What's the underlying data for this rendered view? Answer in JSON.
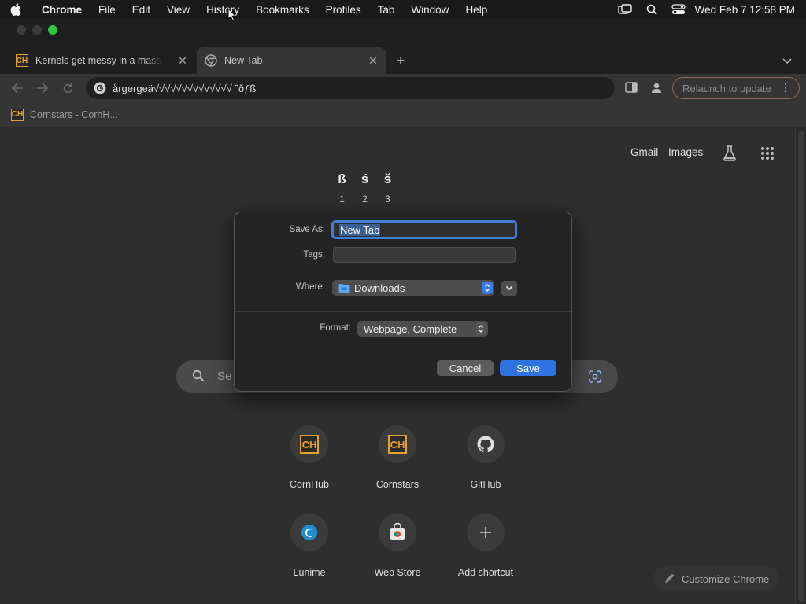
{
  "menubar": {
    "app_name": "Chrome",
    "items": [
      "File",
      "Edit",
      "View",
      "History",
      "Bookmarks",
      "Profiles",
      "Tab",
      "Window",
      "Help"
    ],
    "clock": "Wed Feb 7  12:58 PM"
  },
  "tabs": [
    {
      "title": "Kernels get messy in a mass p",
      "favicon": "CH"
    },
    {
      "title": "New Tab",
      "favicon": "chrome-icon"
    }
  ],
  "omnibox": {
    "value": "årgergeä√√√√√√√√√√√√√√ ˆðƒß"
  },
  "relaunch": {
    "label": "Relaunch to update"
  },
  "bookmarks": [
    {
      "label": "Cornstars - CornH...",
      "favicon": "CH"
    }
  ],
  "ntp": {
    "top_links": {
      "gmail": "Gmail",
      "images": "Images"
    },
    "logo_chars": [
      {
        "char": "ß",
        "num": "1"
      },
      {
        "char": "ś",
        "num": "2"
      },
      {
        "char": "š",
        "num": "3"
      }
    ],
    "search_placeholder": "Se",
    "shortcuts": [
      {
        "label": "CornHub",
        "icon": "CH"
      },
      {
        "label": "Cornstars",
        "icon": "CH"
      },
      {
        "label": "GitHub",
        "icon": "github-icon"
      },
      {
        "label": "Lunime",
        "icon": "lunime-icon"
      },
      {
        "label": "Web Store",
        "icon": "webstore-icon"
      },
      {
        "label": "Add shortcut",
        "icon": "plus-icon"
      }
    ],
    "customize_label": "Customize Chrome"
  },
  "dialog": {
    "save_as_label": "Save As:",
    "save_as_value": "New Tab",
    "tags_label": "Tags:",
    "where_label": "Where:",
    "where_value": "Downloads",
    "format_label": "Format:",
    "format_value": "Webpage, Complete",
    "cancel_label": "Cancel",
    "save_label": "Save"
  },
  "colors": {
    "accent_blue": "#2f72e0",
    "focus_ring": "#3f7fd6",
    "traffic_green": "#2dc840"
  }
}
